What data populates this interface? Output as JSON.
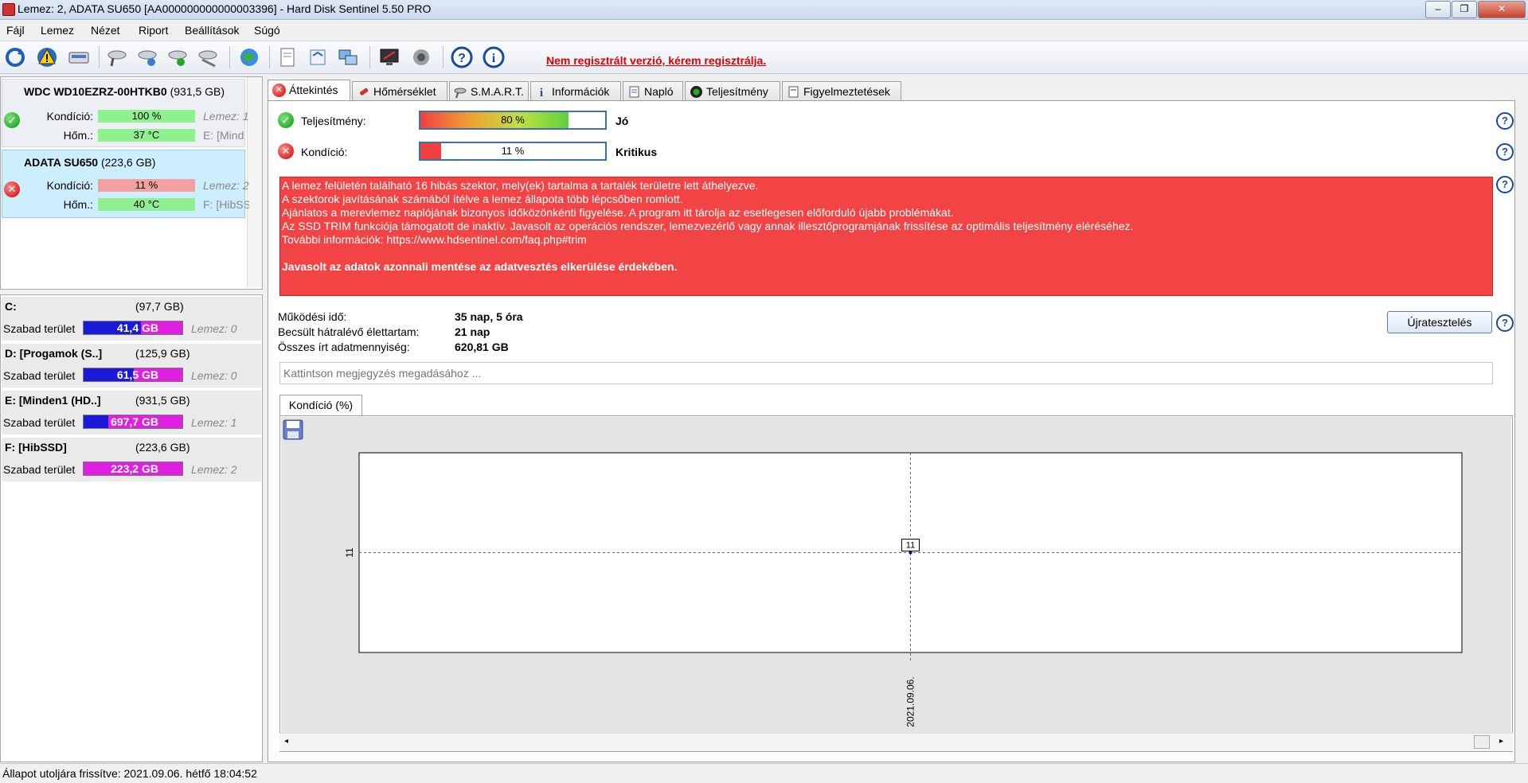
{
  "window": {
    "title": "Lemez: 2, ADATA SU650 [AA000000000000003396]  -  Hard Disk Sentinel 5.50 PRO",
    "minimize": "–",
    "maximize": "❐",
    "close": "✕"
  },
  "menu": {
    "items": [
      {
        "label": "Fájl"
      },
      {
        "label": "Lemez"
      },
      {
        "label": "Nézet"
      },
      {
        "label": "Riport"
      },
      {
        "label": "Beállítások"
      },
      {
        "label": "Súgó"
      }
    ]
  },
  "toolbar": {
    "register_link": "Nem regisztrált verzió, kérem regisztrálja.",
    "icons": [
      "refresh-icon",
      "warning-icon",
      "disk-icon",
      "disk-search-icon",
      "disk-info-icon",
      "disk-check-icon",
      "disk-tools-icon",
      "globe-icon",
      "report-icon",
      "sync-icon",
      "network-icon",
      "monitor-icon",
      "speaker-icon",
      "help-icon",
      "info-icon"
    ]
  },
  "disks": [
    {
      "name": "WDC WD10EZRZ-00HTKB0",
      "size": "(931,5 GB)",
      "condition_label": "Kondíció:",
      "condition_value": "100 %",
      "condition_pct": 100,
      "temp_label": "Hőm.:",
      "temp_value": "37 °C",
      "side1": "Lemez: 1",
      "side2": "E: [Mind",
      "status": "ok"
    },
    {
      "name": "ADATA SU650",
      "size": "(223,6 GB)",
      "condition_label": "Kondíció:",
      "condition_value": "11 %",
      "condition_pct": 11,
      "temp_label": "Hőm.:",
      "temp_value": "40 °C",
      "side1": "Lemez: 2",
      "side2": "F: [HibSS",
      "status": "bad"
    }
  ],
  "volumes": [
    {
      "name": "C:",
      "size": "(97,7 GB)",
      "free_label": "Szabad terület",
      "free_value": "41,4 GB",
      "lemez": "Lemez: 0",
      "used_pct": 58
    },
    {
      "name": "D: [Progamok (S..]",
      "size": "(125,9 GB)",
      "free_label": "Szabad terület",
      "free_value": "61,5 GB",
      "lemez": "Lemez: 0",
      "used_pct": 51
    },
    {
      "name": "E: [Minden1 (HD..]",
      "size": "(931,5 GB)",
      "free_label": "Szabad terület",
      "free_value": "697,7 GB",
      "lemez": "Lemez: 1",
      "used_pct": 25
    },
    {
      "name": "F: [HibSSD]",
      "size": "(223,6 GB)",
      "free_label": "Szabad terület",
      "free_value": "223,2 GB",
      "lemez": "Lemez: 2",
      "used_pct": 0
    }
  ],
  "tabs": [
    {
      "label": "Áttekintés",
      "icon": "error-icon"
    },
    {
      "label": "Hőmérséklet",
      "icon": "thermometer-icon"
    },
    {
      "label": "S.M.A.R.T.",
      "icon": "smart-icon"
    },
    {
      "label": "Információk",
      "icon": "info-icon"
    },
    {
      "label": "Napló",
      "icon": "log-icon"
    },
    {
      "label": "Teljesítmény",
      "icon": "gauge-icon"
    },
    {
      "label": "Figyelmeztetések",
      "icon": "warnings-icon"
    }
  ],
  "overview": {
    "performance_label": "Teljesítmény:",
    "performance_value": "80 %",
    "performance_pct": 80,
    "performance_status": "Jó",
    "condition_label": "Kondíció:",
    "condition_value": "11 %",
    "condition_pct": 11,
    "condition_status": "Kritikus",
    "alert_lines": [
      "A lemez felületén található 16 hibás szektor, mely(ek) tartalma a tartalék területre lett áthelyezve.",
      "A szektorok javításának számából ítélve a lemez állapota több lépcsőben romlott.",
      "Ajánlatos a merevlemez naplójának bizonyos időközönkénti figyelése. A program itt tárolja az esetlegesen előforduló újabb problémákat.",
      "Az SSD TRIM funkciója támogatott de inaktív. Javasolt az operációs rendszer, lemezvezérlő vagy annak illesztőprogramjának frissítése az optimális teljesítmény eléréséhez.",
      "További információk: https://www.hdsentinel.com/faq.php#trim"
    ],
    "alert_bold": "Javasolt az adatok azonnali mentése az adatvesztés elkerülése érdekében.",
    "uptime_label": "Működési idő:",
    "uptime_value": "35 nap, 5 óra",
    "lifetime_label": "Becsült hátralévő élettartam:",
    "lifetime_value": "21 nap",
    "written_label": "Összes írt adatmennyiség:",
    "written_value": "620,81 GB",
    "retest_button": "Újratesztelés",
    "note_placeholder": "Kattintson megjegyzés megadásához ...",
    "chart_tab": "Kondíció  (%)",
    "help": "?"
  },
  "chart_data": {
    "type": "line",
    "title": "",
    "xlabel": "",
    "ylabel": "",
    "x": [
      "2021.09.06."
    ],
    "series": [
      {
        "values": [
          11
        ]
      }
    ],
    "y_ticks": [
      "11"
    ],
    "x_ticks": [
      "2021.09.06."
    ],
    "point_label": "11",
    "grid": true
  },
  "status_bar": {
    "text": "Állapot utoljára frissítve: 2021.09.06. hétfő 18:04:52"
  },
  "colors": {
    "ok_green": "#8ef08e",
    "bad_red": "#f05a5a",
    "alert_bg": "#f24444",
    "volume_used": "#1a1ad8",
    "volume_free": "#e020e0",
    "link_red": "#e00000"
  }
}
